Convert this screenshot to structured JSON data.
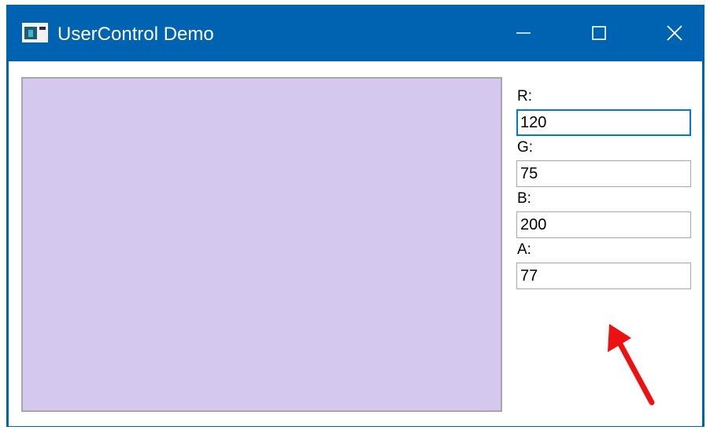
{
  "window": {
    "title": "UserControl Demo",
    "app_icon": "window-app-icon",
    "controls": [
      "minimize-icon",
      "maximize-icon",
      "close-icon"
    ]
  },
  "preview": {
    "color": "#d5c8ee",
    "rgba": {
      "r": 120,
      "g": 75,
      "b": 200,
      "a": 77
    }
  },
  "fields": [
    {
      "label": "R:",
      "value": "120",
      "focused": true
    },
    {
      "label": "G:",
      "value": "75",
      "focused": false
    },
    {
      "label": "B:",
      "value": "200",
      "focused": false
    },
    {
      "label": "A:",
      "value": "77",
      "focused": false
    }
  ],
  "annotation": {
    "icon": "red-arrow-icon",
    "color": "#ee1111"
  },
  "colors": {
    "titlebar": "#0063b1",
    "focus": "#0078d7",
    "border": "#a7a7a7"
  }
}
